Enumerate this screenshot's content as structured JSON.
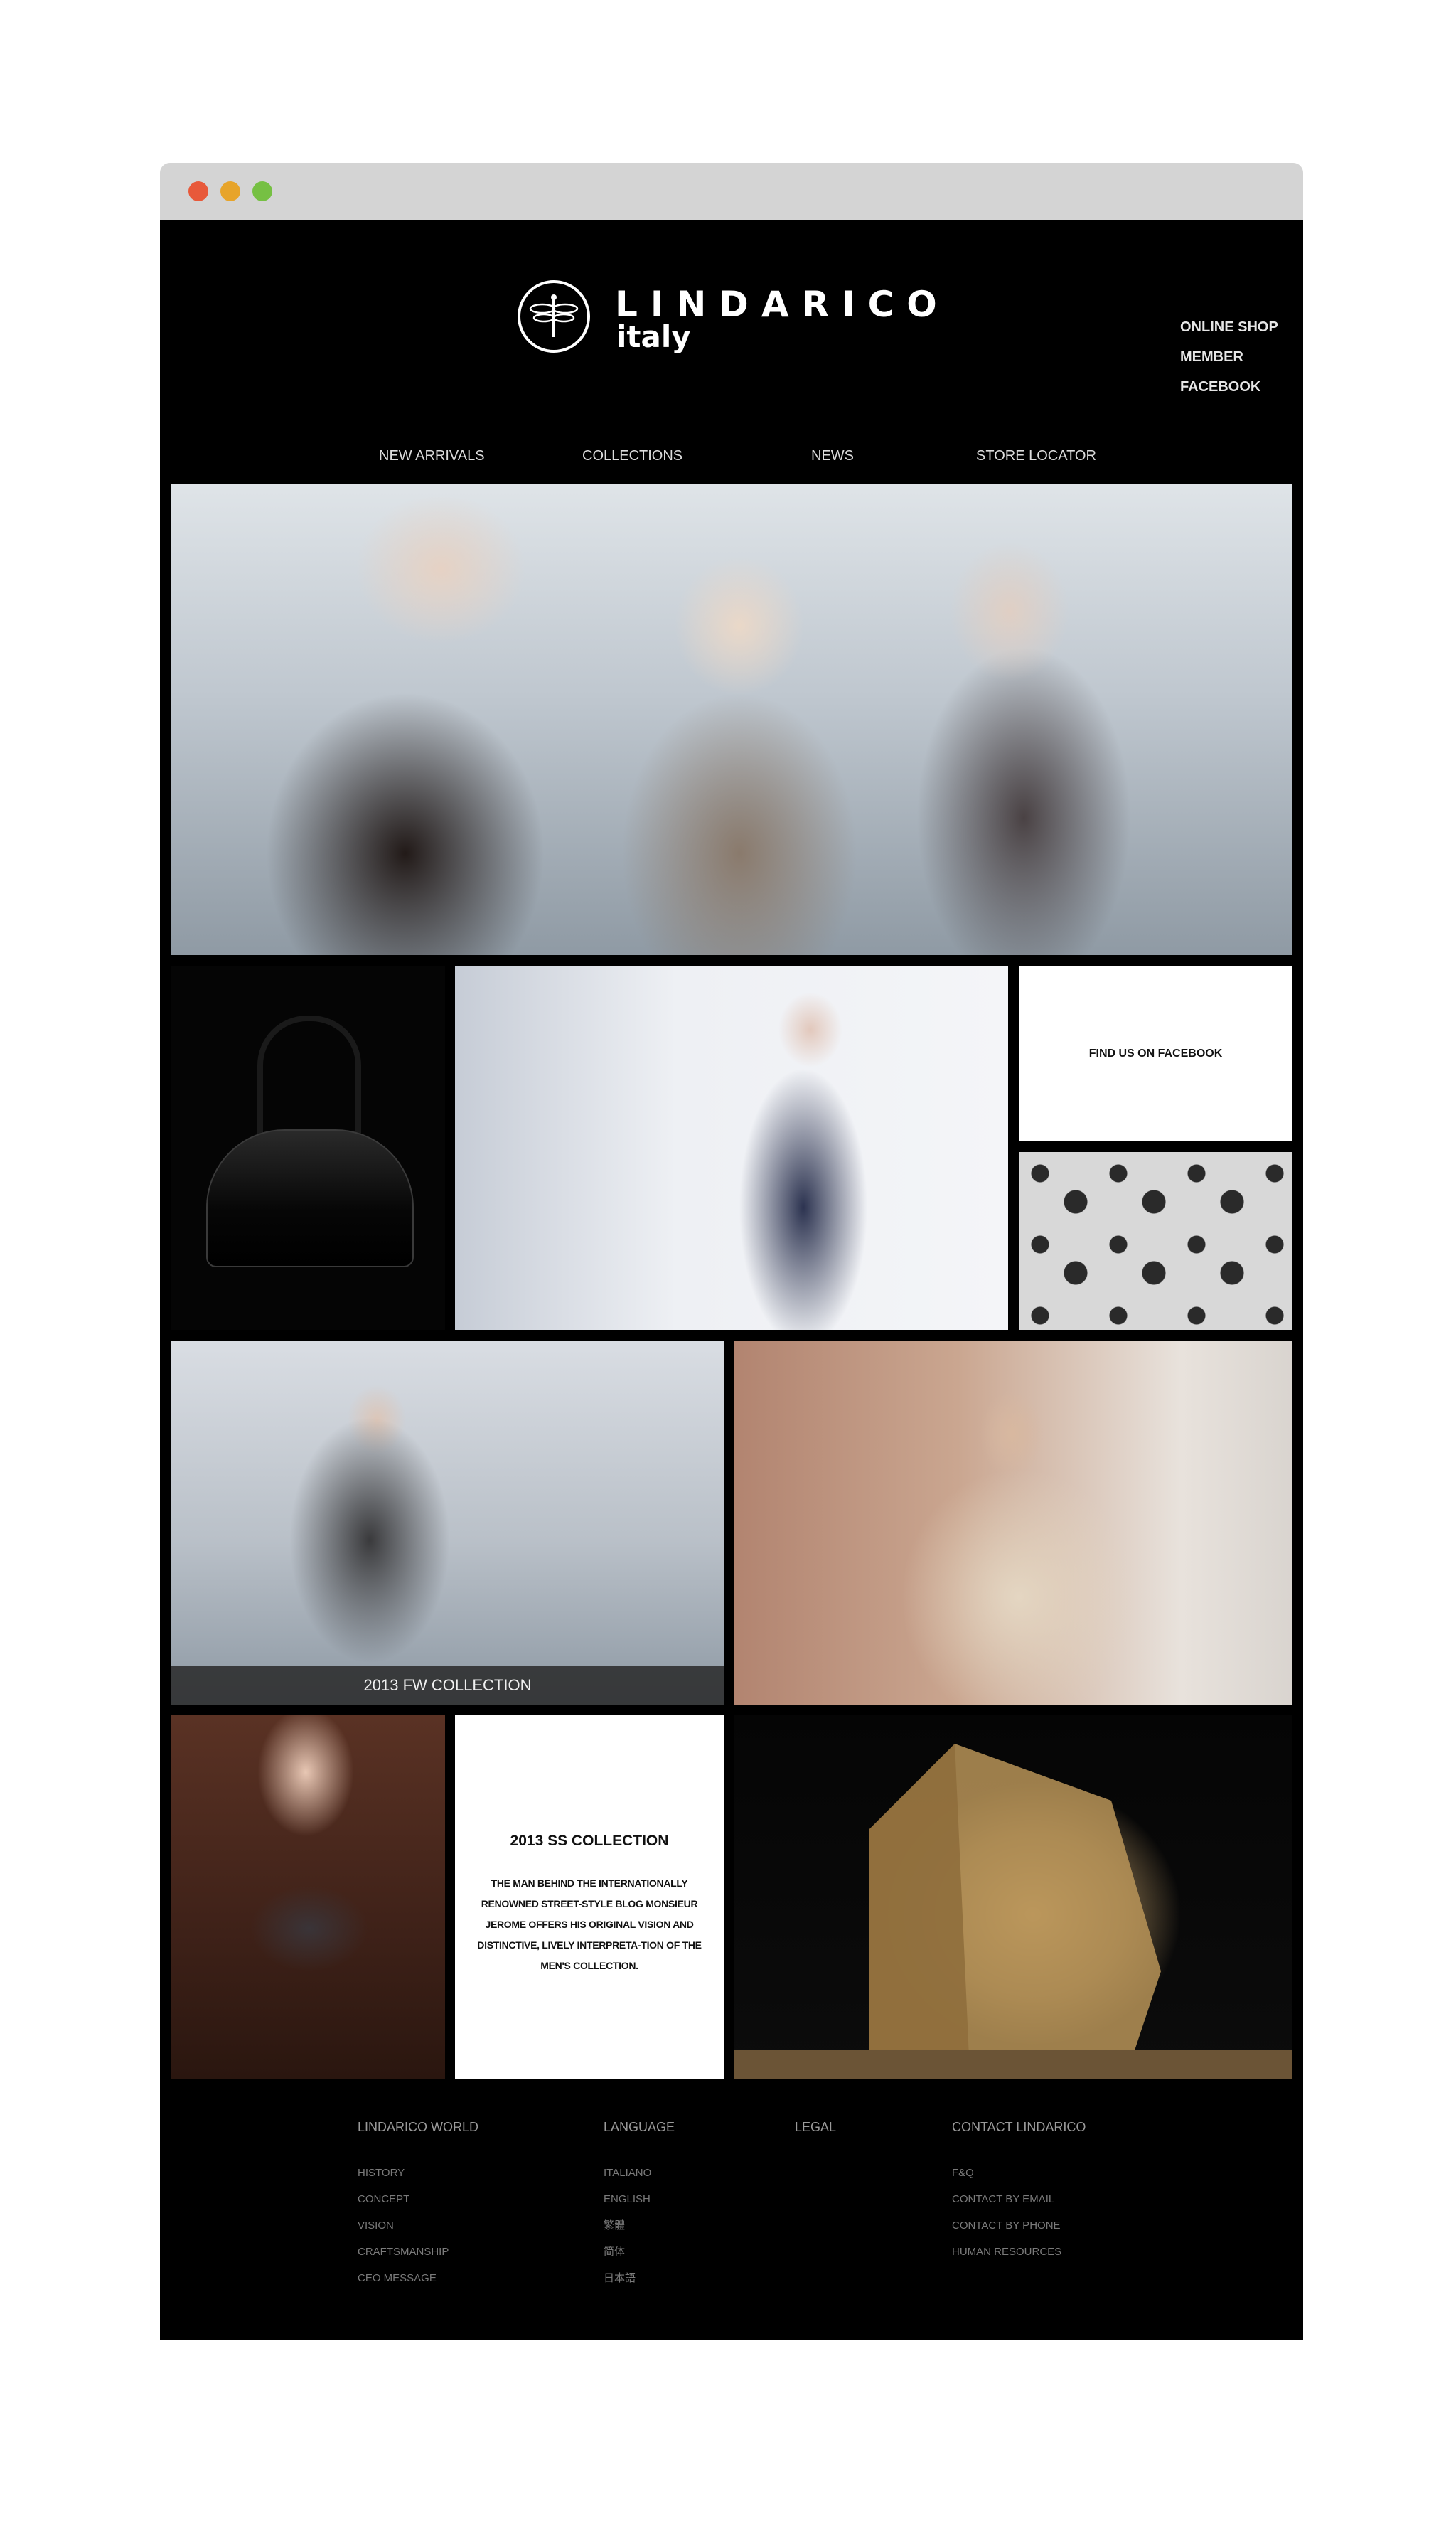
{
  "brand": {
    "name": "LINDARICO",
    "sub": "italy"
  },
  "header_links": [
    "ONLINE SHOP",
    "MEMBER",
    "FACEBOOK"
  ],
  "nav": {
    "new_arrivals": "NEW ARRIVALS",
    "collections": "COLLECTIONS",
    "news": "NEWS",
    "store_locator": "STORE LOCATOR"
  },
  "tiles": {
    "facebook_label": "FIND US ON FACEBOOK",
    "fw_caption": "2013 FW COLLECTION",
    "ss_title": "2013 SS COLLECTION",
    "ss_text": "THE MAN BEHIND THE INTERNATIONALLY RENOWNED STREET-STYLE BLOG MONSIEUR JEROME OFFERS HIS ORIGINAL VISION AND DISTINCTIVE, LIVELY INTERPRETA-TION OF THE MEN'S COLLECTION."
  },
  "footer": {
    "world": {
      "heading": "LINDARICO WORLD",
      "links": [
        "HISTORY",
        "CONCEPT",
        "VISION",
        "CRAFTSMANSHIP",
        "CEO MESSAGE"
      ]
    },
    "language": {
      "heading": "LANGUAGE",
      "links": [
        "ITALIANO",
        "ENGLISH",
        "繁體",
        "简体",
        "日本語"
      ]
    },
    "legal": {
      "heading": "LEGAL"
    },
    "contact": {
      "heading": "CONTACT LINDARICO",
      "links": [
        "F&Q",
        "CONTACT BY EMAIL",
        "CONTACT BY PHONE",
        "HUMAN RESOURCES"
      ]
    }
  },
  "colors": {
    "background": "#000000",
    "chrome": "#d4d4d4",
    "dot_red": "#e8593a",
    "dot_yellow": "#e7a42a",
    "dot_green": "#76c043"
  },
  "icons": [
    "dragonfly-logo-icon"
  ]
}
